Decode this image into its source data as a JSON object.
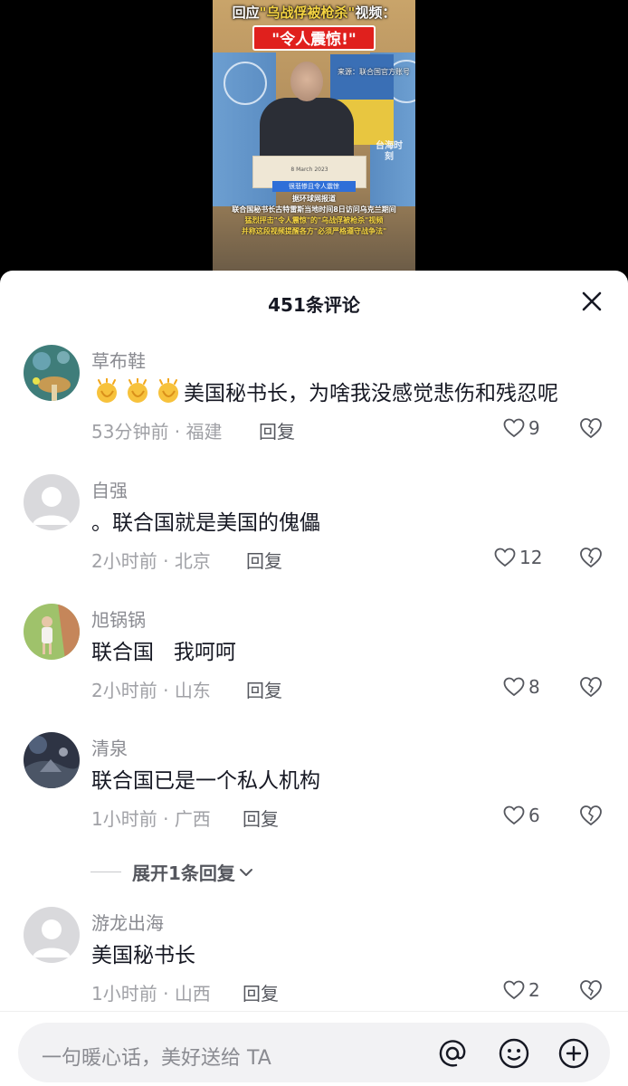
{
  "video": {
    "title_line1_prefix": "回应",
    "title_line1_highlight": "\"乌战俘被枪杀\"",
    "title_line1_suffix": "视频：",
    "big_label": "\"令人震惊!\"",
    "source": "来源：联合国官方账号",
    "watermark": "台海时刻",
    "podium_text": "8 March 2023",
    "caption_badge": "很悲惨且令人震惊",
    "caption_lines": [
      "据环球网报道",
      "联合国秘书长古特雷斯当地时间8日访问乌克兰期间",
      "猛烈抨击\"令人震惊\"的\"乌战俘被枪杀\"视频",
      "并称这段视频提醒各方\"必须严格遵守战争法\""
    ]
  },
  "sheet": {
    "title": "451条评论"
  },
  "comments": [
    {
      "username": "草布鞋",
      "text": "美国秘书长，为啥我没感觉悲伤和残忍呢",
      "emoji_prefix": "clapping-hands ×3",
      "time": "53分钟前",
      "location": "福建",
      "reply_label": "回复",
      "likes": "9"
    },
    {
      "username": "自强",
      "text": "。联合国就是美国的傀儡",
      "time": "2小时前",
      "location": "北京",
      "reply_label": "回复",
      "likes": "12"
    },
    {
      "username": "旭锅锅",
      "text": "联合国   我呵呵",
      "time": "2小时前",
      "location": "山东",
      "reply_label": "回复",
      "likes": "8"
    },
    {
      "username": "清泉",
      "text": "联合国已是一个私人机构",
      "time": "1小时前",
      "location": "广西",
      "reply_label": "回复",
      "likes": "6"
    },
    {
      "username": "游龙出海",
      "text": "美国秘书长",
      "time": "1小时前",
      "location": "山西",
      "reply_label": "回复",
      "likes": "2"
    }
  ],
  "expand_replies_label": "展开1条回复",
  "input": {
    "placeholder": "一句暖心话，美好送给 TA"
  },
  "icons": {
    "close": "close-icon",
    "like": "heart-icon",
    "dislike": "broken-heart-icon",
    "mention": "at-icon",
    "emoji": "smiley-icon",
    "add": "plus-circle-icon",
    "expand": "chevron-down-icon"
  },
  "colors": {
    "text_primary": "#161823",
    "text_secondary": "#8a8b91",
    "caption_highlight": "#f5d442",
    "label_red": "#e0201d"
  }
}
